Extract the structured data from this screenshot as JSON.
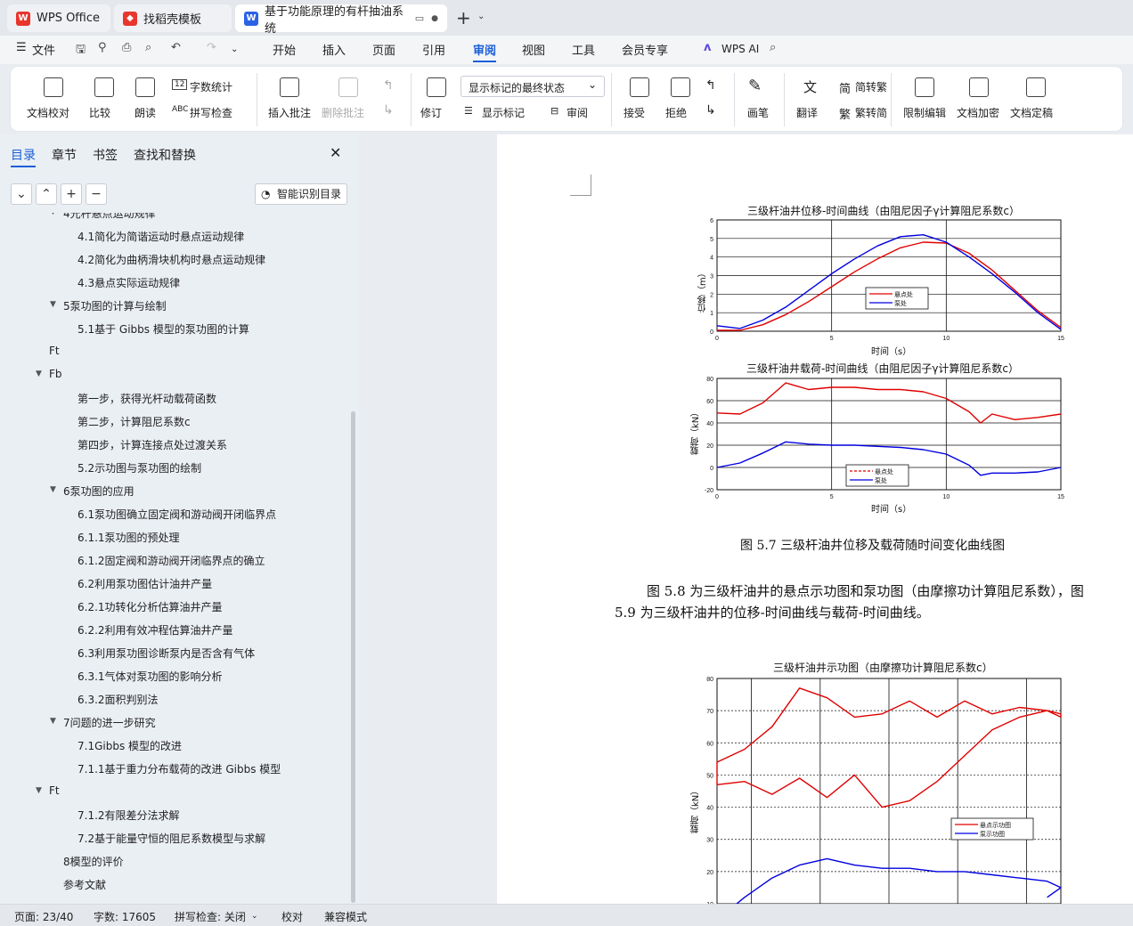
{
  "tabs": [
    {
      "label": "WPS Office",
      "icon": "wps-logo-icon"
    },
    {
      "label": "找稻壳模板",
      "icon": "docer-logo-icon"
    },
    {
      "label": "基于功能原理的有杆抽油系统",
      "icon": "word-doc-icon"
    }
  ],
  "menu": {
    "file": "文件",
    "items": [
      "开始",
      "插入",
      "页面",
      "引用",
      "审阅",
      "视图",
      "工具",
      "会员专享"
    ],
    "ai": "WPS AI"
  },
  "ribbon": {
    "proof": "文档校对",
    "compare": "比较",
    "read": "朗读",
    "wordcount": "字数统计",
    "spell": "拼写检查",
    "insert_comment": "插入批注",
    "delete_comment": "删除批注",
    "revise": "修订",
    "markup_state": "显示标记的最终状态",
    "show_markup": "显示标记",
    "review": "审阅",
    "accept": "接受",
    "reject": "拒绝",
    "pen": "画笔",
    "translate": "翻译",
    "to_trad": "简转繁",
    "to_simp": "繁转简",
    "restrict": "限制编辑",
    "encrypt": "文档加密",
    "finalize": "文档定稿"
  },
  "sidebar": {
    "tabs": [
      "目录",
      "章节",
      "书签",
      "查找和替换"
    ],
    "smart_btn": "智能识别目录",
    "toc": [
      {
        "text": "4光杆悬点运动规律",
        "level": 1,
        "exp": true
      },
      {
        "text": "4.1简化为简谐运动时悬点运动规律",
        "level": 2
      },
      {
        "text": "4.2简化为曲柄滑块机构时悬点运动规律",
        "level": 2
      },
      {
        "text": "4.3悬点实际运动规律",
        "level": 2
      },
      {
        "text": "5泵功图的计算与绘制",
        "level": 1,
        "exp": true
      },
      {
        "text": "5.1基于 Gibbs 模型的泵功图的计算",
        "level": 2
      },
      {
        "text": "Ft",
        "level": 0
      },
      {
        "text": "Fb",
        "level": 0,
        "exp": true
      },
      {
        "text": "第一步，获得光杆动载荷函数",
        "level": 2
      },
      {
        "text": "第二步，计算阻尼系数c",
        "level": 2
      },
      {
        "text": "第四步，计算连接点处过渡关系",
        "level": 2
      },
      {
        "text": "5.2示功图与泵功图的绘制",
        "level": 2
      },
      {
        "text": "6泵功图的应用",
        "level": 1,
        "exp": true
      },
      {
        "text": "6.1泵功图确立固定阀和游动阀开闭临界点",
        "level": 2
      },
      {
        "text": "6.1.1泵功图的预处理",
        "level": 2
      },
      {
        "text": "6.1.2固定阀和游动阀开闭临界点的确立",
        "level": 2
      },
      {
        "text": "6.2利用泵功图估计油井产量",
        "level": 2
      },
      {
        "text": "6.2.1功转化分析估算油井产量",
        "level": 2
      },
      {
        "text": "6.2.2利用有效冲程估算油井产量",
        "level": 2
      },
      {
        "text": "6.3利用泵功图诊断泵内是否含有气体",
        "level": 2
      },
      {
        "text": "6.3.1气体对泵功图的影响分析",
        "level": 2
      },
      {
        "text": "6.3.2面积判别法",
        "level": 2
      },
      {
        "text": "7问题的进一步研究",
        "level": 1,
        "exp": true
      },
      {
        "text": "7.1Gibbs 模型的改进",
        "level": 2
      },
      {
        "text": "7.1.1基于重力分布载荷的改进 Gibbs 模型",
        "level": 2
      },
      {
        "text": "Ft",
        "level": 0,
        "exp": true
      },
      {
        "text": "7.1.2有限差分法求解",
        "level": 2
      },
      {
        "text": "7.2基于能量守恒的阻尼系数模型与求解",
        "level": 2
      },
      {
        "text": "8模型的评价",
        "level": 1
      },
      {
        "text": "参考文献",
        "level": 1
      }
    ]
  },
  "document": {
    "fig1_title": "三级杆油井位移-时间曲线（由阻尼因子γ计算阻尼系数c）",
    "fig1_ylabel": "位移（m）",
    "fig1_xlabel": "时间（s）",
    "fig2_title": "三级杆油井载荷-时间曲线（由阻尼因子γ计算阻尼系数c）",
    "fig2_ylabel": "载荷（kN）",
    "fig2_xlabel": "时间（s）",
    "legend_a": "悬点处",
    "legend_b": "泵处",
    "caption": "图 5.7 三级杆油井位移及载荷随时间变化曲线图",
    "para_line1": "图 5.8 为三级杆油井的悬点示功图和泵功图（由摩擦功计算阻尼系数），图",
    "para_line2": "5.9 为三级杆油井的位移-时间曲线与载荷-时间曲线。",
    "fig3_title": "三级杆油井示功图（由摩擦功计算阻尼系数c）",
    "fig3_ylabel": "载荷（kN）",
    "fig3_legend_a": "悬点示功图",
    "fig3_legend_b": "泵示功图"
  },
  "chart_data": [
    {
      "type": "line",
      "title": "三级杆油井位移-时间曲线（由阻尼因子γ计算阻尼系数c）",
      "xlabel": "时间（s）",
      "ylabel": "位移（m）",
      "xlim": [
        0,
        15
      ],
      "ylim": [
        0,
        6
      ],
      "x_ticks": [
        0,
        5,
        10,
        15
      ],
      "y_ticks": [
        0,
        1,
        2,
        3,
        4,
        5,
        6
      ],
      "grid": true,
      "legend": "center",
      "series": [
        {
          "name": "悬点处",
          "color": "#e00000",
          "x": [
            0,
            1,
            2,
            3,
            4,
            5,
            6,
            7,
            8,
            9,
            10,
            11,
            12,
            13,
            14,
            15
          ],
          "y": [
            0.05,
            0.05,
            0.35,
            0.9,
            1.6,
            2.4,
            3.2,
            3.9,
            4.5,
            4.8,
            4.75,
            4.2,
            3.3,
            2.2,
            1.1,
            0.2
          ]
        },
        {
          "name": "泵处",
          "color": "#0000e0",
          "x": [
            0,
            1,
            2,
            3,
            4,
            5,
            6,
            7,
            8,
            9,
            10,
            11,
            12,
            13,
            14,
            15
          ],
          "y": [
            0.3,
            0.15,
            0.6,
            1.3,
            2.2,
            3.1,
            3.9,
            4.6,
            5.1,
            5.2,
            4.8,
            4.0,
            3.1,
            2.1,
            1.0,
            0.1
          ]
        }
      ]
    },
    {
      "type": "line",
      "title": "三级杆油井载荷-时间曲线（由阻尼因子γ计算阻尼系数c）",
      "xlabel": "时间（s）",
      "ylabel": "载荷（kN）",
      "xlim": [
        0,
        15
      ],
      "ylim": [
        -20,
        80
      ],
      "x_ticks": [
        0,
        5,
        10,
        15
      ],
      "y_ticks": [
        -20,
        0,
        20,
        40,
        60,
        80
      ],
      "grid": true,
      "legend": "center-bottom",
      "series": [
        {
          "name": "悬点处",
          "color": "#e00000",
          "x": [
            0,
            1,
            2,
            3,
            4,
            5,
            6,
            7,
            8,
            9,
            10,
            11,
            11.5,
            12,
            13,
            14,
            15
          ],
          "y": [
            49,
            48,
            58,
            76,
            70,
            72,
            72,
            70,
            70,
            68,
            62,
            50,
            40,
            48,
            43,
            45,
            48
          ]
        },
        {
          "name": "泵处",
          "color": "#0000e0",
          "x": [
            0,
            1,
            2,
            3,
            4,
            5,
            6,
            7,
            8,
            9,
            10,
            11,
            11.5,
            12,
            13,
            14,
            15
          ],
          "y": [
            0,
            4,
            13,
            23,
            21,
            20,
            20,
            19,
            18,
            16,
            12,
            2,
            -7,
            -5,
            -5,
            -4,
            0
          ]
        }
      ]
    },
    {
      "type": "line",
      "title": "三级杆油井示功图（由摩擦功计算阻尼系数c）",
      "ylabel": "载荷（kN）",
      "ylim": [
        10,
        80
      ],
      "y_ticks": [
        10,
        20,
        30,
        40,
        50,
        60,
        70,
        80
      ],
      "grid": true,
      "legend": "center-right",
      "series": [
        {
          "name": "悬点示功图",
          "color": "#e00000",
          "x": [
            0,
            2,
            4,
            6,
            8,
            10,
            12,
            14,
            16,
            18,
            20,
            22,
            24,
            25,
            25,
            24,
            22,
            20,
            18,
            16,
            14,
            12,
            10,
            8,
            6,
            4,
            2,
            0,
            0
          ],
          "y": [
            47,
            48,
            44,
            49,
            43,
            50,
            40,
            42,
            48,
            56,
            64,
            68,
            70,
            69,
            68,
            70,
            71,
            69,
            73,
            68,
            73,
            69,
            68,
            74,
            77,
            65,
            58,
            54,
            47
          ]
        },
        {
          "name": "泵示功图",
          "color": "#0000e0",
          "x": [
            0,
            2,
            4,
            6,
            8,
            10,
            12,
            14,
            16,
            18,
            20,
            22,
            24,
            25,
            24
          ],
          "y": [
            5,
            12,
            18,
            22,
            24,
            22,
            21,
            21,
            20,
            20,
            19,
            18,
            17,
            15,
            12
          ]
        }
      ]
    }
  ],
  "status": {
    "page": "页面: 23/40",
    "words": "字数: 17605",
    "spell": "拼写检查: 关闭",
    "proof": "校对",
    "compat": "兼容模式"
  }
}
